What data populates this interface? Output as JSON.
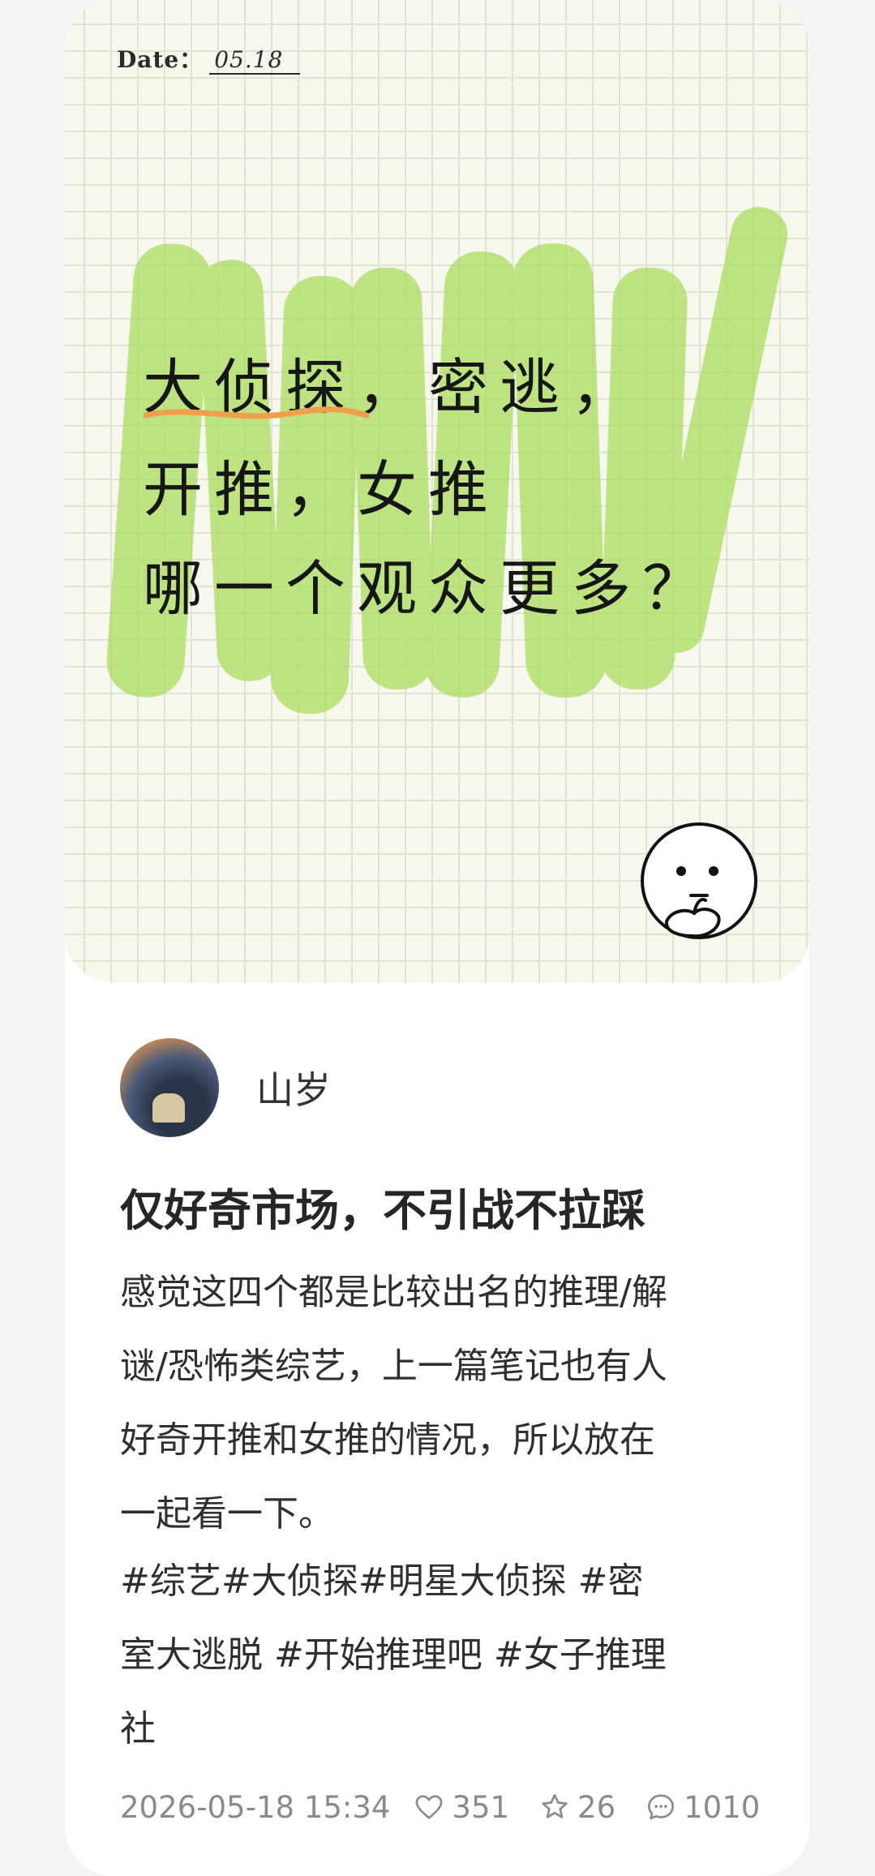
{
  "cover": {
    "date_label": "Date：",
    "date_value": "05.18",
    "line1": "大侦探，密逃，",
    "line2": "开推，女推",
    "line3": "哪一个观众更多？",
    "highlight_color": "#a8dc5a",
    "underline_color": "#f0a04c"
  },
  "author": {
    "name": "山岁"
  },
  "post": {
    "title": "仅好奇市场，不引战不拉踩",
    "body_lines": [
      "感觉这四个都是比较出名的推理/解",
      "谜/恐怖类综艺，上一篇笔记也有人",
      "好奇开推和女推的情况，所以放在",
      "一起看一下。"
    ],
    "tag_lines": [
      "#综艺#大侦探#明星大侦探 #密",
      "室大逃脱 #开始推理吧 #女子推理",
      "社"
    ]
  },
  "meta": {
    "timestamp": "2026-05-18 15:34",
    "likes": "351",
    "favorites": "26",
    "comments": "1010"
  }
}
